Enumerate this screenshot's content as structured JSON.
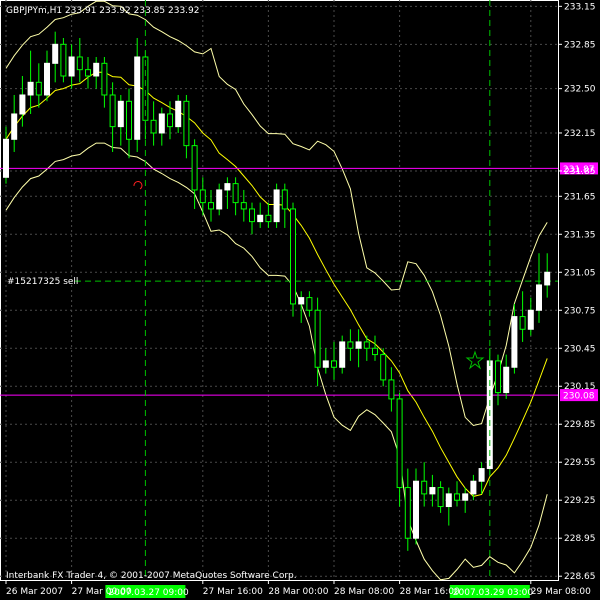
{
  "header": {
    "title": "GBPJPYm,H1  233.91 233.92 233.85 233.92"
  },
  "footer": {
    "copyright": "Interbank FX Trader 4, © 2001-2007 MetaQuotes Software Corp."
  },
  "order_label": "#15217325 sell",
  "colors": {
    "background": "#000000",
    "bull_candle": "#ffffff",
    "bear_candle": "#00ff00",
    "middle_band": "#ffff00",
    "outer_band": "#ffffaa",
    "grid": "#4a4a4a",
    "horizontal_line": "#ff00ff",
    "vertical_marker": "#00c000",
    "marker_label_bg": "#00ff00",
    "order_line": "#00c000"
  },
  "chart_data": {
    "type": "candlestick",
    "symbol": "GBPJPYm",
    "timeframe": "H1",
    "ylim": [
      228.62,
      233.2
    ],
    "y_ticks": [
      "233.15",
      "232.85",
      "232.50",
      "232.15",
      "231.85",
      "231.65",
      "231.35",
      "231.05",
      "230.75",
      "230.45",
      "230.15",
      "229.85",
      "229.55",
      "229.25",
      "228.95",
      "228.65"
    ],
    "x_ticks": [
      {
        "index": 0,
        "label": "26 Mar 2007"
      },
      {
        "index": 8,
        "label": "27 Mar 00:00"
      },
      {
        "index": 24,
        "label": "27 Mar 16:00"
      },
      {
        "index": 32,
        "label": "28 Mar 00:00"
      },
      {
        "index": 40,
        "label": "28 Mar 08:00"
      },
      {
        "index": 48,
        "label": "28 Mar 16:00"
      },
      {
        "index": 64,
        "label": "29 Mar 08:00"
      }
    ],
    "horizontal_lines": [
      {
        "name": "upper",
        "value": 231.87,
        "label": "231.87"
      },
      {
        "name": "lower",
        "value": 230.08,
        "label": "230.08"
      }
    ],
    "order_line": {
      "value": 230.98,
      "label": "#15217325 sell"
    },
    "vertical_markers": [
      {
        "index": 17,
        "label": "2007.03.27 09:00"
      },
      {
        "index": 59,
        "label": "2007.03.29 03:00"
      }
    ],
    "candles": [
      {
        "o": 231.8,
        "h": 232.2,
        "l": 231.75,
        "c": 232.1
      },
      {
        "o": 232.1,
        "h": 232.45,
        "l": 232.0,
        "c": 232.3
      },
      {
        "o": 232.3,
        "h": 232.6,
        "l": 232.2,
        "c": 232.45
      },
      {
        "o": 232.45,
        "h": 232.8,
        "l": 232.3,
        "c": 232.55
      },
      {
        "o": 232.55,
        "h": 232.7,
        "l": 232.35,
        "c": 232.45
      },
      {
        "o": 232.45,
        "h": 232.8,
        "l": 232.4,
        "c": 232.7
      },
      {
        "o": 232.7,
        "h": 232.95,
        "l": 232.55,
        "c": 232.85
      },
      {
        "o": 232.85,
        "h": 232.9,
        "l": 232.55,
        "c": 232.6
      },
      {
        "o": 232.6,
        "h": 232.85,
        "l": 232.5,
        "c": 232.75
      },
      {
        "o": 232.75,
        "h": 232.9,
        "l": 232.55,
        "c": 232.65
      },
      {
        "o": 232.65,
        "h": 232.75,
        "l": 232.5,
        "c": 232.6
      },
      {
        "o": 232.6,
        "h": 232.75,
        "l": 232.5,
        "c": 232.7
      },
      {
        "o": 232.7,
        "h": 232.75,
        "l": 232.35,
        "c": 232.45
      },
      {
        "o": 232.45,
        "h": 232.55,
        "l": 232.0,
        "c": 232.2
      },
      {
        "o": 232.2,
        "h": 232.45,
        "l": 232.05,
        "c": 232.4
      },
      {
        "o": 232.4,
        "h": 232.5,
        "l": 231.95,
        "c": 232.1
      },
      {
        "o": 232.1,
        "h": 232.9,
        "l": 232.0,
        "c": 232.75
      },
      {
        "o": 232.75,
        "h": 232.8,
        "l": 232.1,
        "c": 232.25
      },
      {
        "o": 232.25,
        "h": 232.4,
        "l": 232.05,
        "c": 232.15
      },
      {
        "o": 232.15,
        "h": 232.35,
        "l": 232.05,
        "c": 232.3
      },
      {
        "o": 232.3,
        "h": 232.4,
        "l": 232.1,
        "c": 232.2
      },
      {
        "o": 232.2,
        "h": 232.45,
        "l": 232.15,
        "c": 232.4
      },
      {
        "o": 232.4,
        "h": 232.45,
        "l": 231.95,
        "c": 232.05
      },
      {
        "o": 232.05,
        "h": 232.1,
        "l": 231.55,
        "c": 231.7
      },
      {
        "o": 231.7,
        "h": 231.8,
        "l": 231.5,
        "c": 231.6
      },
      {
        "o": 231.6,
        "h": 231.7,
        "l": 231.45,
        "c": 231.55
      },
      {
        "o": 231.55,
        "h": 231.75,
        "l": 231.5,
        "c": 231.7
      },
      {
        "o": 231.7,
        "h": 231.8,
        "l": 231.55,
        "c": 231.75
      },
      {
        "o": 231.75,
        "h": 231.8,
        "l": 231.5,
        "c": 231.6
      },
      {
        "o": 231.6,
        "h": 231.7,
        "l": 231.45,
        "c": 231.55
      },
      {
        "o": 231.55,
        "h": 231.6,
        "l": 231.35,
        "c": 231.45
      },
      {
        "o": 231.45,
        "h": 231.6,
        "l": 231.4,
        "c": 231.5
      },
      {
        "o": 231.5,
        "h": 231.6,
        "l": 231.4,
        "c": 231.45
      },
      {
        "o": 231.45,
        "h": 231.75,
        "l": 231.4,
        "c": 231.7
      },
      {
        "o": 231.7,
        "h": 231.75,
        "l": 231.4,
        "c": 231.55
      },
      {
        "o": 231.55,
        "h": 231.6,
        "l": 230.7,
        "c": 230.8
      },
      {
        "o": 230.8,
        "h": 230.9,
        "l": 230.65,
        "c": 230.85
      },
      {
        "o": 230.85,
        "h": 230.9,
        "l": 230.7,
        "c": 230.75
      },
      {
        "o": 230.75,
        "h": 230.85,
        "l": 230.15,
        "c": 230.3
      },
      {
        "o": 230.3,
        "h": 230.45,
        "l": 230.25,
        "c": 230.35
      },
      {
        "o": 230.35,
        "h": 230.5,
        "l": 230.2,
        "c": 230.3
      },
      {
        "o": 230.3,
        "h": 230.55,
        "l": 230.25,
        "c": 230.5
      },
      {
        "o": 230.5,
        "h": 230.6,
        "l": 230.35,
        "c": 230.45
      },
      {
        "o": 230.45,
        "h": 230.6,
        "l": 230.3,
        "c": 230.5
      },
      {
        "o": 230.5,
        "h": 230.55,
        "l": 230.35,
        "c": 230.45
      },
      {
        "o": 230.45,
        "h": 230.55,
        "l": 230.35,
        "c": 230.4
      },
      {
        "o": 230.4,
        "h": 230.45,
        "l": 230.15,
        "c": 230.2
      },
      {
        "o": 230.2,
        "h": 230.3,
        "l": 229.95,
        "c": 230.05
      },
      {
        "o": 230.05,
        "h": 230.1,
        "l": 229.2,
        "c": 229.35
      },
      {
        "o": 229.35,
        "h": 229.5,
        "l": 228.85,
        "c": 228.95
      },
      {
        "o": 228.95,
        "h": 229.5,
        "l": 228.9,
        "c": 229.4
      },
      {
        "o": 229.4,
        "h": 229.55,
        "l": 229.2,
        "c": 229.3
      },
      {
        "o": 229.3,
        "h": 229.45,
        "l": 229.2,
        "c": 229.35
      },
      {
        "o": 229.35,
        "h": 229.4,
        "l": 229.15,
        "c": 229.2
      },
      {
        "o": 229.2,
        "h": 229.35,
        "l": 229.05,
        "c": 229.3
      },
      {
        "o": 229.3,
        "h": 229.4,
        "l": 229.2,
        "c": 229.25
      },
      {
        "o": 229.25,
        "h": 229.35,
        "l": 229.15,
        "c": 229.3
      },
      {
        "o": 229.3,
        "h": 229.45,
        "l": 229.25,
        "c": 229.4
      },
      {
        "o": 229.4,
        "h": 229.55,
        "l": 229.3,
        "c": 229.5
      },
      {
        "o": 229.5,
        "h": 230.45,
        "l": 229.45,
        "c": 230.35
      },
      {
        "o": 230.35,
        "h": 230.4,
        "l": 230.0,
        "c": 230.1
      },
      {
        "o": 230.1,
        "h": 230.4,
        "l": 230.05,
        "c": 230.3
      },
      {
        "o": 230.3,
        "h": 230.8,
        "l": 230.25,
        "c": 230.7
      },
      {
        "o": 230.7,
        "h": 230.9,
        "l": 230.5,
        "c": 230.6
      },
      {
        "o": 230.6,
        "h": 230.85,
        "l": 230.55,
        "c": 230.75
      },
      {
        "o": 230.75,
        "h": 231.2,
        "l": 230.65,
        "c": 230.95
      },
      {
        "o": 230.95,
        "h": 231.2,
        "l": 230.85,
        "c": 231.05
      }
    ]
  }
}
